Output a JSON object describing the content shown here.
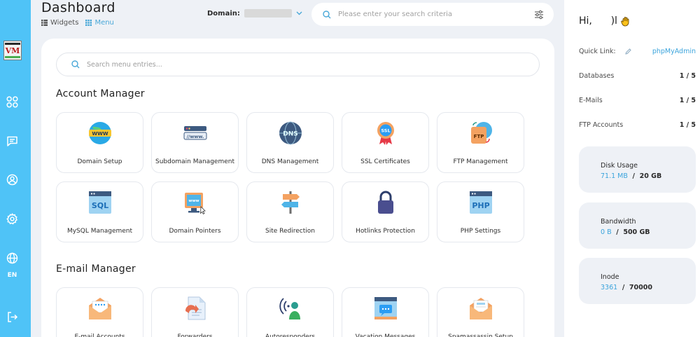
{
  "header": {
    "title": "Dashboard",
    "widgets_label": "Widgets",
    "menu_label": "Menu",
    "domain_label": "Domain:",
    "search_placeholder": "Please enter your search criteria"
  },
  "sidebar": {
    "language": "EN",
    "icons": [
      "apps-icon",
      "messages-icon",
      "user-icon",
      "settings-icon",
      "globe-icon",
      "logout-icon"
    ]
  },
  "main": {
    "menu_search_placeholder": "Search menu entries...",
    "sections": [
      {
        "title": "Account Manager",
        "items": [
          {
            "label": "Domain Setup",
            "icon": "www-globe-icon"
          },
          {
            "label": "Subdomain Management",
            "icon": "subdomain-icon"
          },
          {
            "label": "DNS Management",
            "icon": "dns-icon"
          },
          {
            "label": "SSL Certificates",
            "icon": "ssl-badge-icon"
          },
          {
            "label": "FTP Management",
            "icon": "ftp-icon"
          },
          {
            "label": "MySQL Management",
            "icon": "sql-icon"
          },
          {
            "label": "Domain Pointers",
            "icon": "domain-pointer-icon"
          },
          {
            "label": "Site Redirection",
            "icon": "signpost-icon"
          },
          {
            "label": "Hotlinks Protection",
            "icon": "padlock-icon"
          },
          {
            "label": "PHP Settings",
            "icon": "php-icon"
          }
        ]
      },
      {
        "title": "E-mail Manager",
        "items": [
          {
            "label": "E-mail Accounts",
            "icon": "email-envelope-icon"
          },
          {
            "label": "Forwarders",
            "icon": "forward-document-icon"
          },
          {
            "label": "Autoresponders",
            "icon": "autoresponder-icon"
          },
          {
            "label": "Vacation Messages",
            "icon": "vacation-message-icon"
          },
          {
            "label": "Spamassassin Setup",
            "icon": "spam-envelope-icon"
          }
        ]
      }
    ]
  },
  "right_panel": {
    "greeting": "Hi,",
    "greeting_name": "      )l",
    "quick_link_label": "Quick Link:",
    "quick_link_value": "phpMyAdmin",
    "rows": [
      {
        "label": "Databases",
        "value": "1 / 5"
      },
      {
        "label": "E-Mails",
        "value": "1 / 5"
      },
      {
        "label": "FTP Accounts",
        "value": "1 / 5"
      }
    ],
    "stats": [
      {
        "title": "Disk Usage",
        "used": "71.1 MB",
        "sep": "/",
        "total": "20 GB"
      },
      {
        "title": "Bandwidth",
        "used": "0 B",
        "sep": "/",
        "total": "500 GB"
      },
      {
        "title": "Inode",
        "used": "3361",
        "sep": "/",
        "total": "70000"
      }
    ]
  },
  "colors": {
    "sidebar": "#4fc3f7",
    "accent": "#3ba4dc",
    "background": "#eef1f6"
  }
}
